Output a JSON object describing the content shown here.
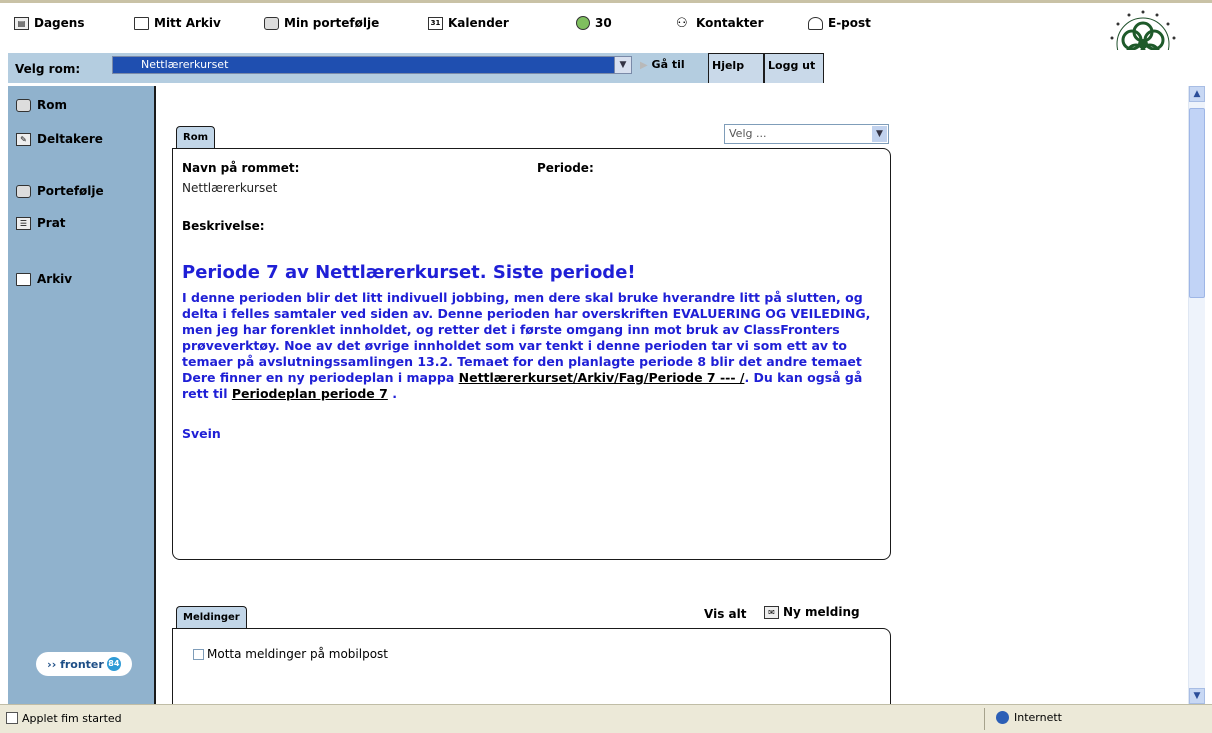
{
  "topmenu": {
    "dagens": "Dagens",
    "mitt_arkiv": "Mitt Arkiv",
    "min_portefolje": "Min portefølje",
    "kalender": "Kalender",
    "counter": "30",
    "kontakter": "Kontakter",
    "epost": "E-post"
  },
  "roombar": {
    "label": "Velg rom:",
    "selected_room": "Nettlærerkurset",
    "goto": "Gå til",
    "help": "Hjelp",
    "logout": "Logg ut"
  },
  "sidebar": {
    "items": [
      {
        "label": "Rom",
        "icon": "room-icon"
      },
      {
        "label": "Deltakere",
        "icon": "participants-icon"
      },
      {
        "label": "Portefølje",
        "icon": "portfolio-icon"
      },
      {
        "label": "Prat",
        "icon": "chat-icon"
      },
      {
        "label": "Arkiv",
        "icon": "folder-icon"
      }
    ],
    "badge": {
      "text": "fronter",
      "dot": "84"
    }
  },
  "rom_panel": {
    "tab": "Rom",
    "velg_placeholder": "Velg ...",
    "navn_label": "Navn på rommet:",
    "navn_value": "Nettlærerkurset",
    "periode_label": "Periode:",
    "beskrivelse_label": "Beskrivelse:",
    "heading": "Periode 7 av Nettlærerkurset. Siste periode!",
    "paragraph": "I denne perioden blir det litt indivuell jobbing, men dere skal bruke hverandre litt på slutten, og delta i felles samtaler ved siden av. Denne perioden har overskriften EVALUERING OG VEILEDING, men jeg har forenklet innholdet, og retter det i første omgang inn mot bruk av ClassFronters prøveverktøy. Noe av det øvrige innholdet som var tenkt i denne perioden tar vi som ett av to temaer på avslutningssamlingen 13.2. Temaet for den planlagte periode 8 blir det andre temaet",
    "finner_prefix": "Dere finner en ny periodeplan i mappa",
    "folder_link": "Nettlærerkurset/Arkiv/Fag/Periode 7 --- /",
    "gaa_rett": ". Du kan også gå rett til",
    "plan_link": "Periodeplan periode 7",
    "end": ".",
    "signature": "Svein"
  },
  "meldinger": {
    "tab": "Meldinger",
    "vis_alt": "Vis alt",
    "ny_melding": "Ny melding",
    "mobil_label": "Motta meldinger på mobilpost"
  },
  "statusbar": {
    "text": "Applet fim started",
    "zone": "Internett"
  },
  "colors": {
    "sidebar": "#90b2cd",
    "accent_text": "#1f1fd6",
    "select_bg": "#1f4fb0"
  }
}
